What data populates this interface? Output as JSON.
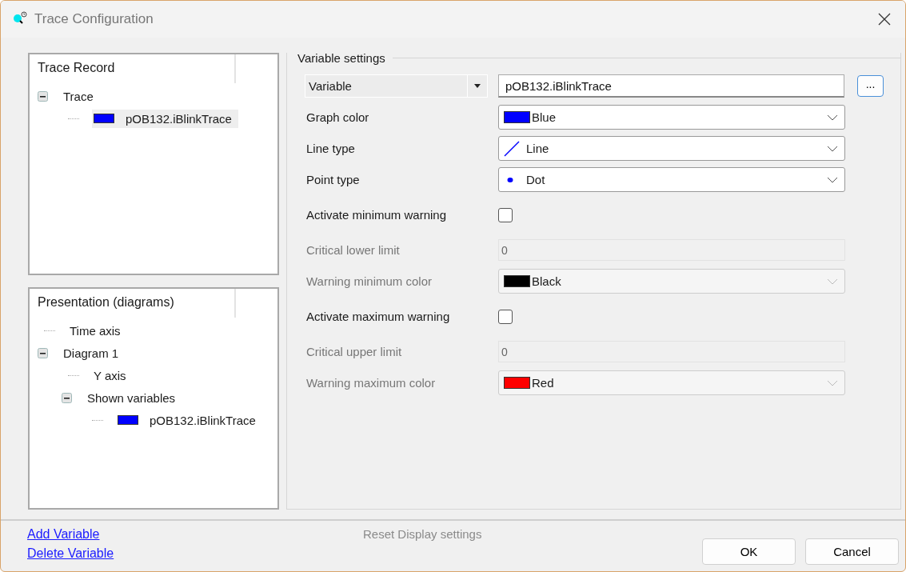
{
  "window": {
    "title": "Trace Configuration"
  },
  "trace_record": {
    "title": "Trace Record",
    "items": [
      {
        "label": "Trace",
        "expanded": true,
        "selected": false,
        "children": [
          {
            "label": "pOB132.iBlinkTrace",
            "color": "#0000ff",
            "selected": true
          }
        ]
      }
    ]
  },
  "presentation": {
    "title": "Presentation (diagrams)",
    "items": [
      {
        "label": "Time axis"
      },
      {
        "label": "Diagram 1",
        "expanded": true,
        "children": [
          {
            "label": "Y axis"
          },
          {
            "label": "Shown variables",
            "expanded": true,
            "children": [
              {
                "label": "pOB132.iBlinkTrace",
                "color": "#0000ff"
              }
            ]
          }
        ]
      }
    ]
  },
  "variable_settings": {
    "title": "Variable settings",
    "selector": "Variable",
    "value": "pOB132.iBlinkTrace",
    "browse_button": "...",
    "rows": [
      {
        "kind": "color-select",
        "label": "Graph color",
        "value": "Blue",
        "color": "#0000ff",
        "disabled": false
      },
      {
        "kind": "line-select",
        "label": "Line type",
        "value": "Line",
        "disabled": false
      },
      {
        "kind": "point-select",
        "label": "Point type",
        "value": "Dot",
        "disabled": false
      },
      {
        "kind": "checkbox",
        "label": "Activate minimum warning",
        "checked": false
      },
      {
        "kind": "field",
        "label": "Critical lower limit",
        "value": "0",
        "disabled": true
      },
      {
        "kind": "color-select",
        "label": "Warning minimum color",
        "value": "Black",
        "color": "#000000",
        "disabled": true
      },
      {
        "kind": "checkbox",
        "label": "Activate maximum warning",
        "checked": false
      },
      {
        "kind": "field",
        "label": "Critical upper limit",
        "value": "0",
        "disabled": true
      },
      {
        "kind": "color-select",
        "label": "Warning maximum color",
        "value": "Red",
        "color": "#ff0000",
        "disabled": true
      }
    ]
  },
  "links": [
    "Add Variable",
    "Delete Variable"
  ],
  "reset_button": {
    "label": "Reset Display settings",
    "disabled": true
  },
  "buttons": [
    "OK",
    "Cancel"
  ]
}
